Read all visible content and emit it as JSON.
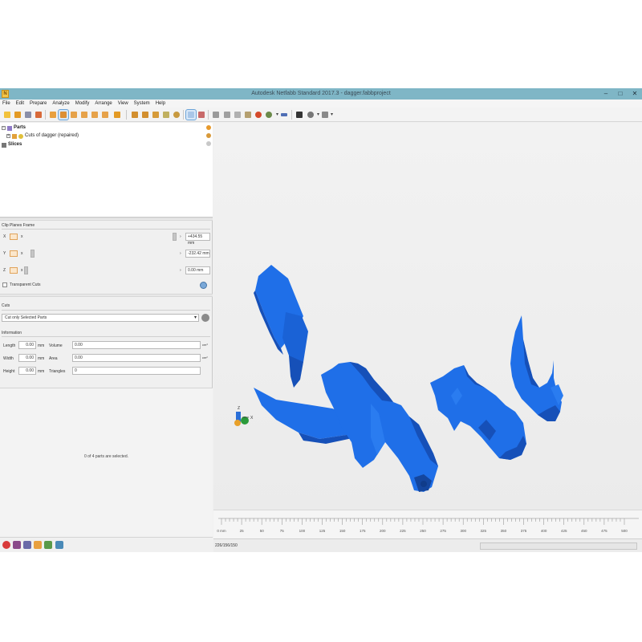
{
  "window": {
    "title": "Autodesk Netfabb Standard 2017.3 - dagger.fabbproject"
  },
  "menu": [
    "File",
    "Edit",
    "Prepare",
    "Analyze",
    "Modify",
    "Arrange",
    "View",
    "System",
    "Help"
  ],
  "tree": {
    "parts_label": "Parts",
    "cut_item_label": "Cuts of dagger (repaired)",
    "slices_label": "Slices"
  },
  "clip_planes": {
    "title": "Clip Planes Frame",
    "x": {
      "axis": "X",
      "label": "x",
      "value": "+434.55 mm"
    },
    "y": {
      "axis": "Y",
      "label": "x",
      "value": "-232.42 mm"
    },
    "z": {
      "axis": "Z",
      "label": "x",
      "value": "0.00 mm"
    },
    "transparent_cuts": "Transparent Cuts"
  },
  "cuts": {
    "title": "Cuts",
    "mode": "Cut only Selected Parts"
  },
  "information": {
    "title": "Information",
    "length": {
      "label": "Length",
      "value": "0.00",
      "unit": "mm"
    },
    "width": {
      "label": "Width",
      "value": "0.00",
      "unit": "mm"
    },
    "height": {
      "label": "Height",
      "value": "0.00",
      "unit": "mm"
    },
    "volume": {
      "label": "Volume",
      "value": "0.00",
      "unit": "cm³"
    },
    "area": {
      "label": "Area",
      "value": "0.00",
      "unit": "cm²"
    },
    "triangles": {
      "label": "Triangles",
      "value": "0"
    }
  },
  "selection_message": "0 of 4 parts are selected.",
  "ruler": {
    "first_label": "0 mm",
    "labels": [
      "25",
      "50",
      "75",
      "100",
      "125",
      "150",
      "175",
      "200",
      "225",
      "250",
      "275",
      "300",
      "325",
      "350",
      "375",
      "400",
      "425",
      "450",
      "475",
      "500"
    ]
  },
  "axis_gizmo": {
    "z": "Z",
    "x": "X"
  },
  "status": {
    "coords": "226/156/150"
  },
  "colors": {
    "model": "#1f6fe8",
    "model_dark": "#1650b8",
    "titlebar": "#7fb6c6"
  }
}
